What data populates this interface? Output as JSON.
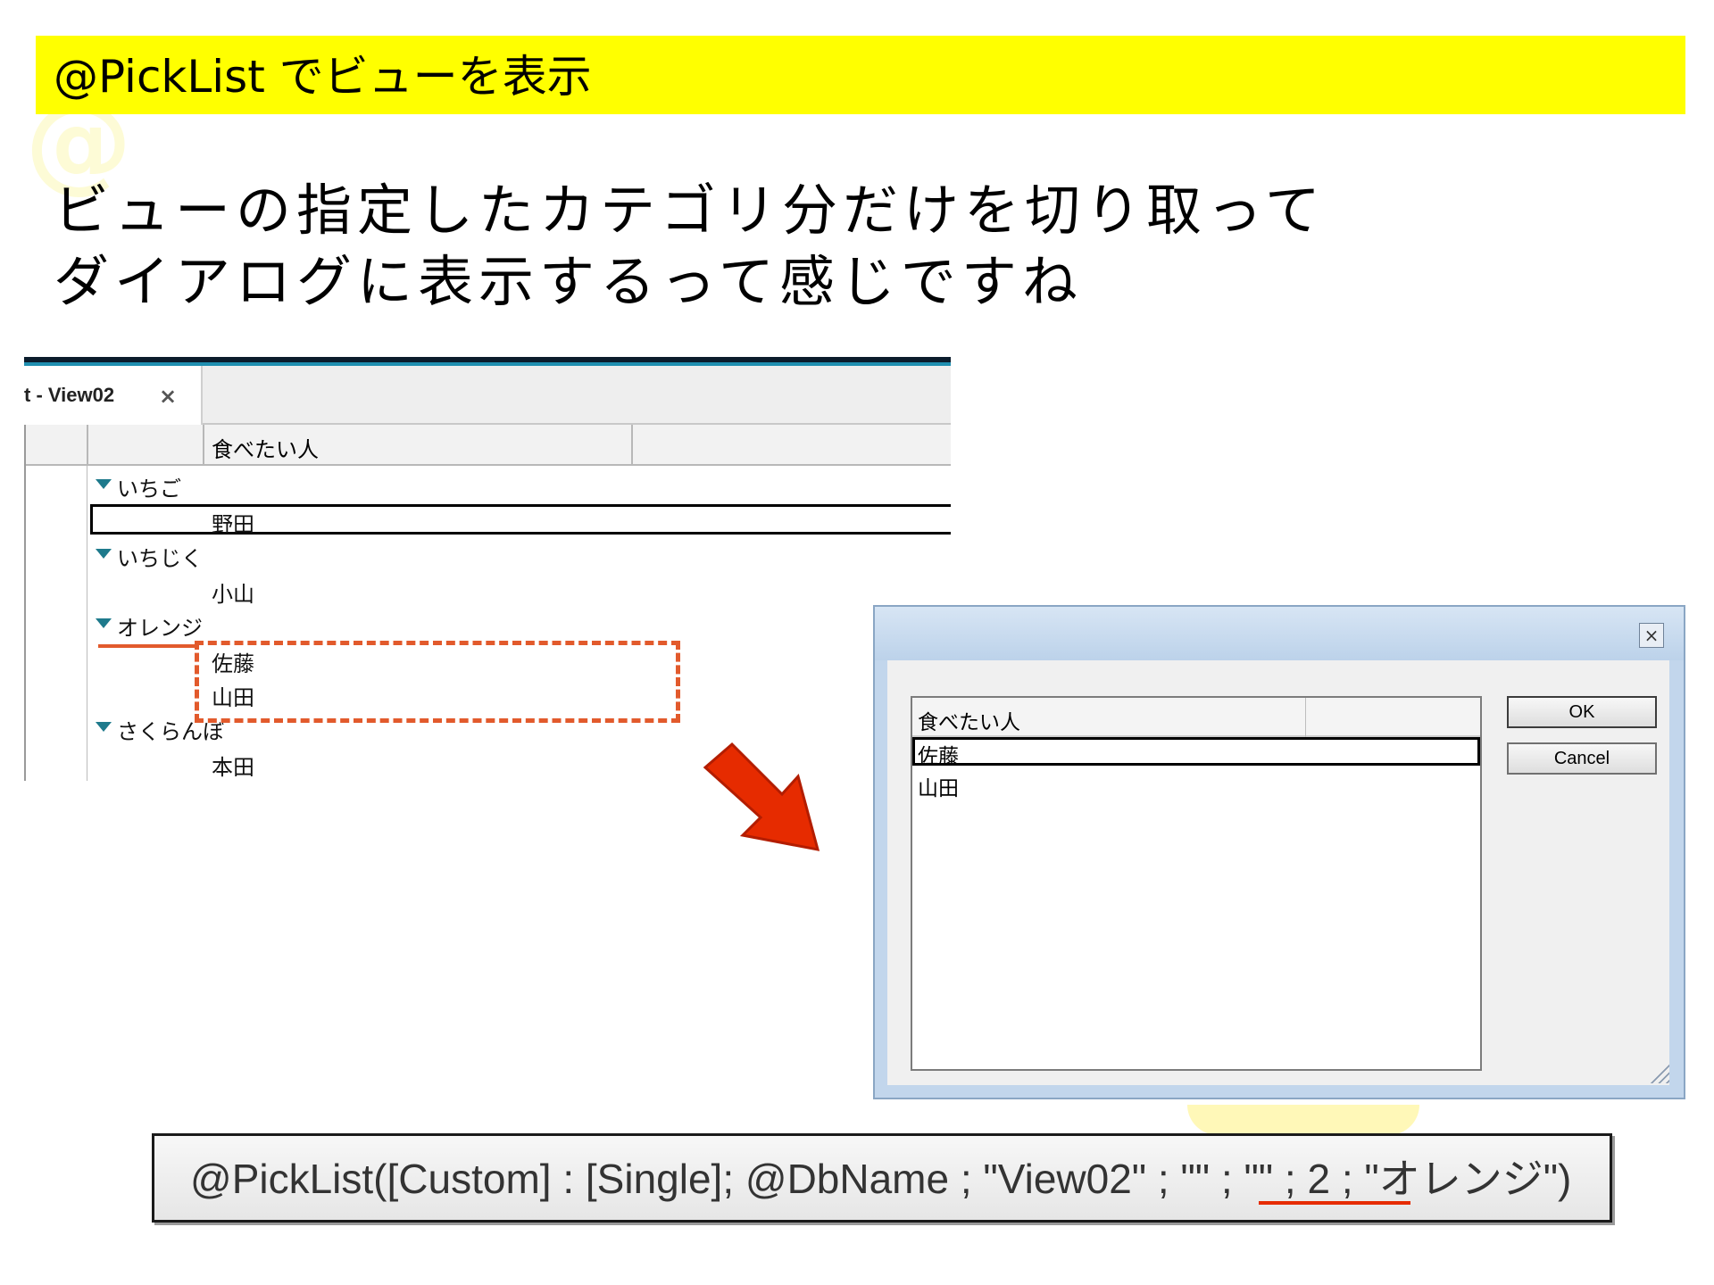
{
  "slide": {
    "title": "@PickList でビューを表示",
    "headline_line1": "ビューの指定したカテゴリ分だけを切り取って",
    "headline_line2": "ダイアログに表示するって感じですね"
  },
  "view": {
    "tab_label": "t - View02",
    "tab_close": "×",
    "column_header": "食べたい人",
    "categories": [
      {
        "label": "いちご",
        "docs": [
          "野田"
        ]
      },
      {
        "label": "いちじく",
        "docs": [
          "小山"
        ]
      },
      {
        "label": "オレンジ",
        "docs": [
          "佐藤",
          "山田"
        ]
      },
      {
        "label": "さくらんぼ",
        "docs": [
          "本田"
        ]
      }
    ]
  },
  "dialog": {
    "close_glyph": "×",
    "list_header": "食べたい人",
    "items": [
      "佐藤",
      "山田"
    ],
    "ok_label": "OK",
    "cancel_label": "Cancel"
  },
  "formula": {
    "text": "@PickList([Custom] : [Single]; @DbName ; \"View02\" ; \"\" ; \"\" ; 2 ; \"オレンジ\")"
  },
  "colors": {
    "title_band": "#ffff00",
    "highlight": "#e25a2c",
    "arrow": "#e62b00",
    "dialog_frame": "#c2d6ec"
  }
}
